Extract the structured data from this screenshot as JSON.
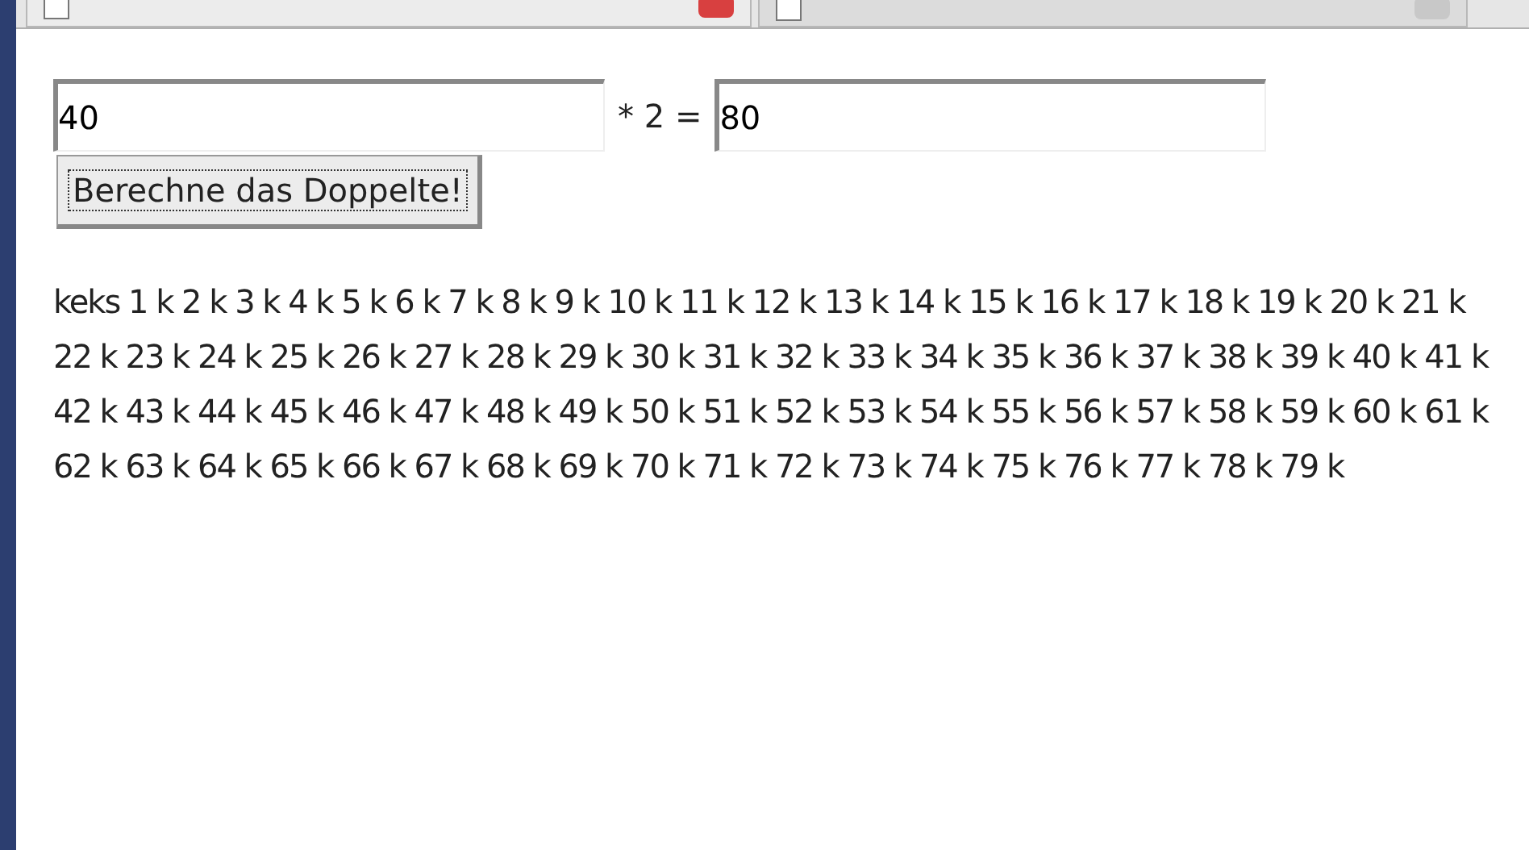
{
  "form": {
    "input_value": "40",
    "operator_label": "* 2 =",
    "result_value": "80",
    "button_label": "Berechne das Doppelte!"
  },
  "output_text": "keks 1 k 2 k 3 k 4 k 5 k 6 k 7 k 8 k 9 k 10 k 11 k 12 k 13 k 14 k 15 k 16 k 17 k 18 k 19 k 20 k 21 k 22 k 23 k 24 k 25 k 26 k 27 k 28 k 29 k 30 k 31 k 32 k 33 k 34 k 35 k 36 k 37 k 38 k 39 k 40 k 41 k 42 k 43 k 44 k 45 k 46 k 47 k 48 k 49 k 50 k 51 k 52 k 53 k 54 k 55 k 56 k 57 k 58 k 59 k 60 k 61 k 62 k 63 k 64 k 65 k 66 k 67 k 68 k 69 k 70 k 71 k 72 k 73 k 74 k 75 k 76 k 77 k 78 k 79 k"
}
